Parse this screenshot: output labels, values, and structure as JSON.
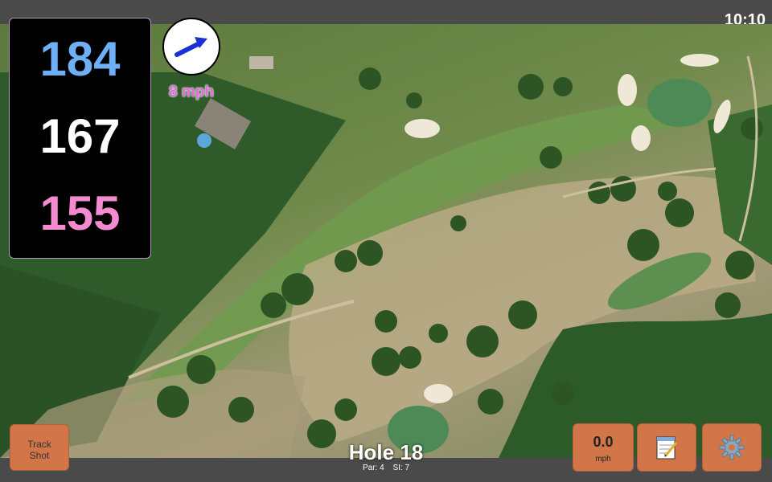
{
  "status": {
    "time": "10:10"
  },
  "yardages": {
    "back": "184",
    "middle": "167",
    "front": "155"
  },
  "wind": {
    "speed_label": "8 mph",
    "icon": "wind-arrow-icon"
  },
  "hole": {
    "title": "Hole 18",
    "par": "Par: 4",
    "si": "SI: 7"
  },
  "buttons": {
    "track_shot": "Track\nShot",
    "speed_value": "0.0",
    "speed_unit": "mph",
    "notes_icon": "notepad-icon",
    "settings_icon": "gear-icon"
  },
  "colors": {
    "back": "#6fb0f5",
    "middle": "#ffffff",
    "front": "#f48bd0",
    "wind_label": "#e06ad8",
    "button": "#d2764a"
  }
}
